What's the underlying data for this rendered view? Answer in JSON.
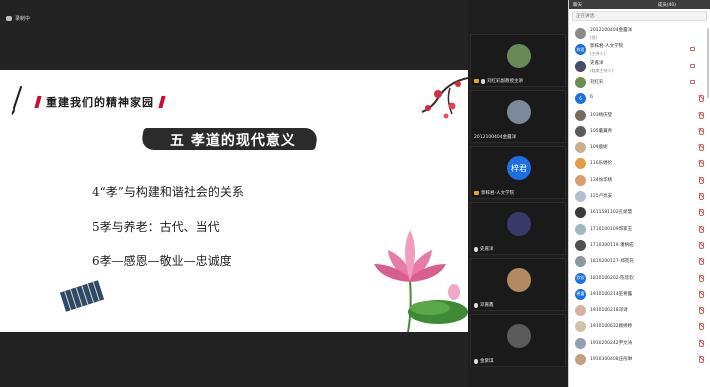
{
  "meeting": {
    "recording_label": "录制中"
  },
  "slide": {
    "banner": "重建我们的精神家园",
    "heading": "五 孝道的现代意义",
    "points": [
      "4“孝”与构建和谐社会的关系",
      "5孝与养老：古代、当代",
      "6孝—感恩—敬业—忠诚度"
    ]
  },
  "tiles": [
    {
      "label": "刘红彩副教授主讲",
      "avatar": "plant-avatar"
    },
    {
      "label": "2012100404金露洋",
      "avatar": "landscape-avatar"
    },
    {
      "label": "郭梓君-人文学院",
      "avatar_text": "梓君",
      "avatar_color": "#1e6fe0"
    },
    {
      "label": "史嘉洋",
      "avatar": "player-avatar"
    },
    {
      "label": "邓嘉鑫",
      "avatar": "cat-avatar"
    },
    {
      "label": "金紫琪",
      "avatar": "figure-avatar"
    }
  ],
  "panel": {
    "tabs": [
      "聊天",
      "成员(40)"
    ],
    "search_placeholder": "正在讲话:",
    "participants": [
      {
        "name": "2012100404金露洋",
        "sub": "(我)",
        "color": "#8a8a8a",
        "muted": false
      },
      {
        "name": "郭梓君-人文学院",
        "sub": "(主持人)",
        "color": "#1e6fe0",
        "avatar_text": "梓君",
        "muted": false
      },
      {
        "name": "史嘉洋",
        "sub": "(联席主持人)",
        "color": "#4a4a6a",
        "muted": false
      },
      {
        "name": "刘红彩",
        "sub": "",
        "color": "#6b8e4e",
        "muted": false
      },
      {
        "name": "6",
        "sub": "",
        "color": "#1e6fe0",
        "avatar_text": "6",
        "muted": true
      },
      {
        "name": "103杨庆登",
        "sub": "",
        "color": "#7a6a5a",
        "muted": true
      },
      {
        "name": "105董翼青",
        "sub": "",
        "color": "#5a5a5a",
        "muted": true
      },
      {
        "name": "109鹿妮",
        "sub": "",
        "color": "#c8b090",
        "muted": true
      },
      {
        "name": "116乐婷伦",
        "sub": "",
        "color": "#e0a040",
        "muted": true
      },
      {
        "name": "134徐华杨",
        "sub": "",
        "color": "#d8a070",
        "muted": true
      },
      {
        "name": "125卢亮安",
        "sub": "",
        "color": "#b0c0d0",
        "muted": true
      },
      {
        "name": "1611581102孔娇慧",
        "sub": "",
        "color": "#3a3a3a",
        "muted": true
      },
      {
        "name": "1710100109郭家玉",
        "sub": "",
        "color": "#a0b8c0",
        "muted": true
      },
      {
        "name": "1710300119 潘柄成",
        "sub": "",
        "color": "#505050",
        "muted": true
      },
      {
        "name": "1810200127-郑宛充",
        "sub": "",
        "color": "#8a9aa0",
        "muted": true
      },
      {
        "name": "1810100202-陈欣钦",
        "sub": "",
        "color": "#1e6fe0",
        "avatar_text": "欣钦",
        "muted": true
      },
      {
        "name": "1910100214巫希露",
        "sub": "",
        "color": "#1e6fe0",
        "avatar_text": "希露",
        "muted": true
      },
      {
        "name": "1910100218邓诗",
        "sub": "",
        "color": "#d8b0a0",
        "muted": true
      },
      {
        "name": "1910100632赖婷婷",
        "sub": "",
        "color": "#d0c0b0",
        "muted": true
      },
      {
        "name": "1910200242尹文涛",
        "sub": "",
        "color": "#90a0b0",
        "muted": true
      },
      {
        "name": "1910300408庄彤琳",
        "sub": "",
        "color": "#c0a080",
        "muted": true
      }
    ]
  },
  "colors": {
    "accent": "#1e6fe0",
    "muted_icon": "#c86464",
    "banner_red": "#c8102e"
  }
}
